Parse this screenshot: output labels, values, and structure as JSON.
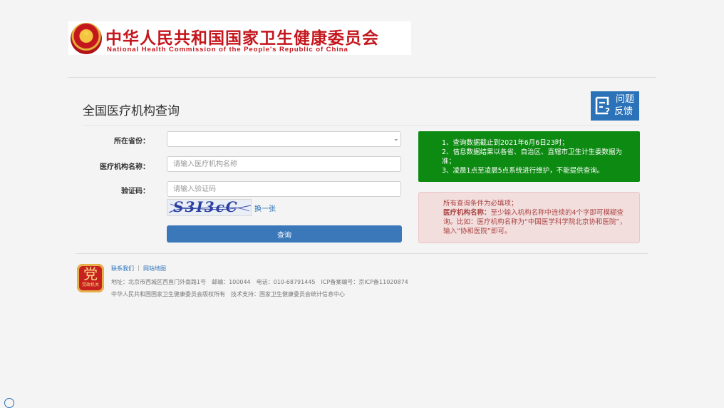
{
  "header": {
    "title_cn": "中华人民共和国国家卫生健康委员会",
    "title_en": "National Health Commission of the People's Republic of China",
    "emblem_icon": "national-emblem-icon"
  },
  "page": {
    "title": "全国医疗机构查询"
  },
  "feedback": {
    "line1": "问题",
    "line2": "反馈",
    "icon": "feedback-icon"
  },
  "form": {
    "province_label": "所在省份：",
    "province_value": "",
    "institution_label": "医疗机构名称：",
    "institution_placeholder": "请输入医疗机构名称",
    "captcha_label": "验证码：",
    "captcha_placeholder": "请输入验证码",
    "captcha_text": "S3I3cC",
    "refresh_label": "换一张",
    "submit_label": "查询"
  },
  "notice_green": {
    "line1": "1、查询数据截止到2021年6月6日23时；",
    "line2": "2、信息数据结果以各省、自治区、直辖市卫生计生委数据为准；",
    "line3": "3、凌晨1点至凌晨5点系统进行维护，不能提供查询。"
  },
  "notice_red": {
    "line1": "所有查询条件为必填项；",
    "bold": "医疗机构名称：",
    "line2": "至少输入机构名称中连续的4个字即可模糊查询。比如：医疗机构名称为“中国医学科学院北京协和医院”，输入“协和医院”即可。"
  },
  "footer": {
    "badge_glyph": "党",
    "badge_text": "党政机关",
    "link_contact": "联系我们",
    "separator": "|",
    "link_sitemap": "网站地图",
    "address": "地址：北京市西城区西直门外南路1号　邮编：100044　电话：010-68791445　ICP备案编号：京ICP备11020874",
    "copyright": "中华人民共和国国家卫生健康委员会版权所有　技术支持：国家卫生健康委员会统计信息中心"
  },
  "colors": {
    "brand_red": "#c4161c",
    "accent_blue": "#2b72b8",
    "notice_green": "#0d8a12",
    "notice_red_bg": "#f3dede"
  }
}
